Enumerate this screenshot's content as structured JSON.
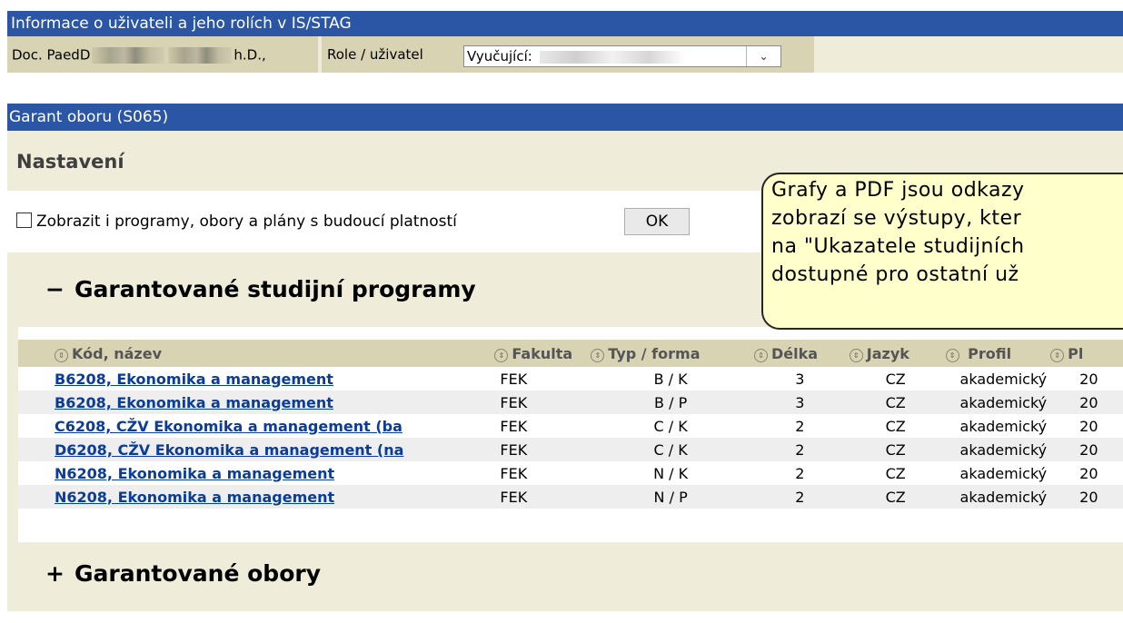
{
  "header": {
    "title": "Informace o uživateli a jeho rolích v IS/STAG",
    "user_prefix": "Doc. PaedD",
    "user_suffix": "h.D.,",
    "role_label": "Role / uživatel",
    "role_value": "Vyučující:"
  },
  "section": {
    "title": "Garant oboru (S065)"
  },
  "settings": {
    "heading": "Nastavení",
    "checkbox_label": "Zobrazit i programy, obory a plány s budoucí platností",
    "checkbox_checked": false,
    "ok_label": "OK"
  },
  "tooltip": {
    "lines": [
      "Grafy a PDF jsou odkazy",
      "zobrazí se výstupy, kter",
      "na \"Ukazatele studijních",
      "dostupné pro ostatní už"
    ]
  },
  "programs_panel": {
    "toggle": "−",
    "title": "Garantované studijní programy"
  },
  "table": {
    "columns": [
      "Kód, název",
      "Fakulta",
      "Typ / forma",
      "Délka",
      "Jazyk",
      "Profil",
      "Pl"
    ],
    "rows": [
      {
        "kod": "B6208, Ekonomika a management",
        "fakulta": "FEK",
        "typ": "B / K",
        "delka": "3",
        "jazyk": "CZ",
        "profil": "akademický",
        "pl": "20"
      },
      {
        "kod": "B6208, Ekonomika a management",
        "fakulta": "FEK",
        "typ": "B / P",
        "delka": "3",
        "jazyk": "CZ",
        "profil": "akademický",
        "pl": "20"
      },
      {
        "kod": "C6208, CŽV Ekonomika a management (ba",
        "fakulta": "FEK",
        "typ": "C / K",
        "delka": "2",
        "jazyk": "CZ",
        "profil": "akademický",
        "pl": "20"
      },
      {
        "kod": "D6208, CŽV Ekonomika a management (na",
        "fakulta": "FEK",
        "typ": "C / K",
        "delka": "2",
        "jazyk": "CZ",
        "profil": "akademický",
        "pl": "20"
      },
      {
        "kod": "N6208, Ekonomika a management",
        "fakulta": "FEK",
        "typ": "N / K",
        "delka": "2",
        "jazyk": "CZ",
        "profil": "akademický",
        "pl": "20"
      },
      {
        "kod": "N6208, Ekonomika a management",
        "fakulta": "FEK",
        "typ": "N / P",
        "delka": "2",
        "jazyk": "CZ",
        "profil": "akademický",
        "pl": "20"
      }
    ]
  },
  "fields_panel": {
    "toggle": "+",
    "title": "Garantované obory"
  }
}
